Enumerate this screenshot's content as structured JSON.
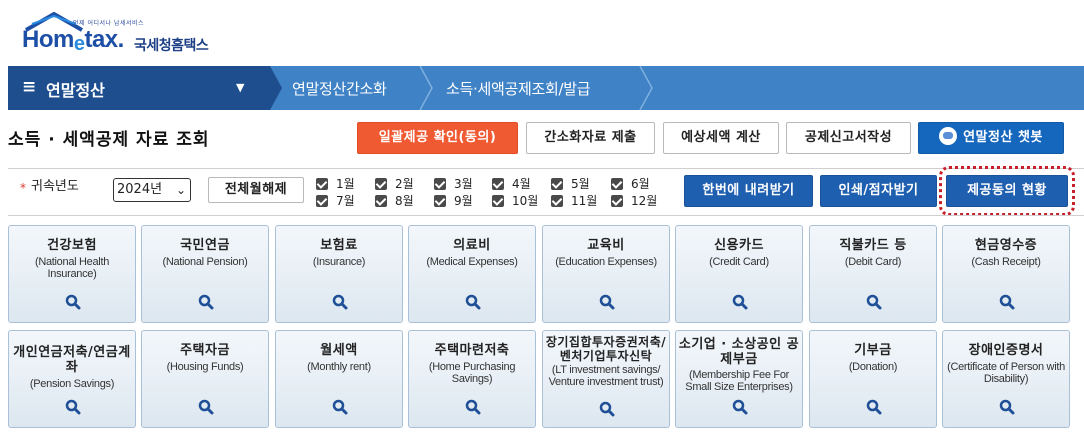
{
  "logo": {
    "tagline": "언제 어디서나 납세서비스",
    "brand_home": "Hom",
    "brand_e": "e",
    "brand_tax": "tax.",
    "brand_kr": "국세청홈택스"
  },
  "nav": {
    "menu_label": "연말정산",
    "breadcrumbs": [
      "연말정산간소화",
      "소득·세액공제조회/발급"
    ]
  },
  "page": {
    "title": "소득 · 세액공제 자료 조회"
  },
  "toolbar": {
    "bulk_consent": "일괄제공 확인(동의)",
    "submit": "간소화자료 제출",
    "estimate": "예상세액 계산",
    "deduction_report": "공제신고서작성",
    "chatbot": "연말정산 챗봇"
  },
  "filter": {
    "required_mark": "*",
    "year_label": "귀속년도",
    "year_value": "2024년",
    "deselect_all": "전체월해제",
    "months": [
      "1월",
      "2월",
      "3월",
      "4월",
      "5월",
      "6월",
      "7월",
      "8월",
      "9월",
      "10월",
      "11월",
      "12월"
    ],
    "download_all": "한번에 내려받기",
    "print": "인쇄/점자받기",
    "consent_status": "제공동의 현황"
  },
  "tiles": [
    {
      "title": "건강보험",
      "sub": "(National Health Insurance)"
    },
    {
      "title": "국민연금",
      "sub": "(National Pension)"
    },
    {
      "title": "보험료",
      "sub": "(Insurance)"
    },
    {
      "title": "의료비",
      "sub": "(Medical Expenses)"
    },
    {
      "title": "교육비",
      "sub": "(Education Expenses)"
    },
    {
      "title": "신용카드",
      "sub": "(Credit Card)"
    },
    {
      "title": "직불카드 등",
      "sub": "(Debit Card)"
    },
    {
      "title": "현금영수증",
      "sub": "(Cash Receipt)"
    },
    {
      "title": "개인연금저축/연금계좌",
      "sub": "(Pension Savings)"
    },
    {
      "title": "주택자금",
      "sub": "(Housing Funds)"
    },
    {
      "title": "월세액",
      "sub": "(Monthly rent)"
    },
    {
      "title": "주택마련저축",
      "sub": "(Home Purchasing Savings)"
    },
    {
      "title": "장기집합투자증권저축/벤처기업투자신탁",
      "sub": "(LT investment savings/ Venture investment trust)"
    },
    {
      "title": "소기업 · 소상공인 공제부금",
      "sub": "(Membership Fee For Small Size Enterprises)"
    },
    {
      "title": "기부금",
      "sub": "(Donation)"
    },
    {
      "title": "장애인증명서",
      "sub": "(Certificate of Person with Disability)"
    }
  ],
  "icons": {
    "tile_action": "magnifier-icon",
    "menu": "hamburger-icon",
    "chatbot": "robot-icon"
  },
  "colors": {
    "nav_dark": "#1f4e8f",
    "nav_light": "#3f82c6",
    "consent_button": "#f05a33",
    "action_blue": "#1f5fb0",
    "highlight_dotted": "#c8202a"
  }
}
